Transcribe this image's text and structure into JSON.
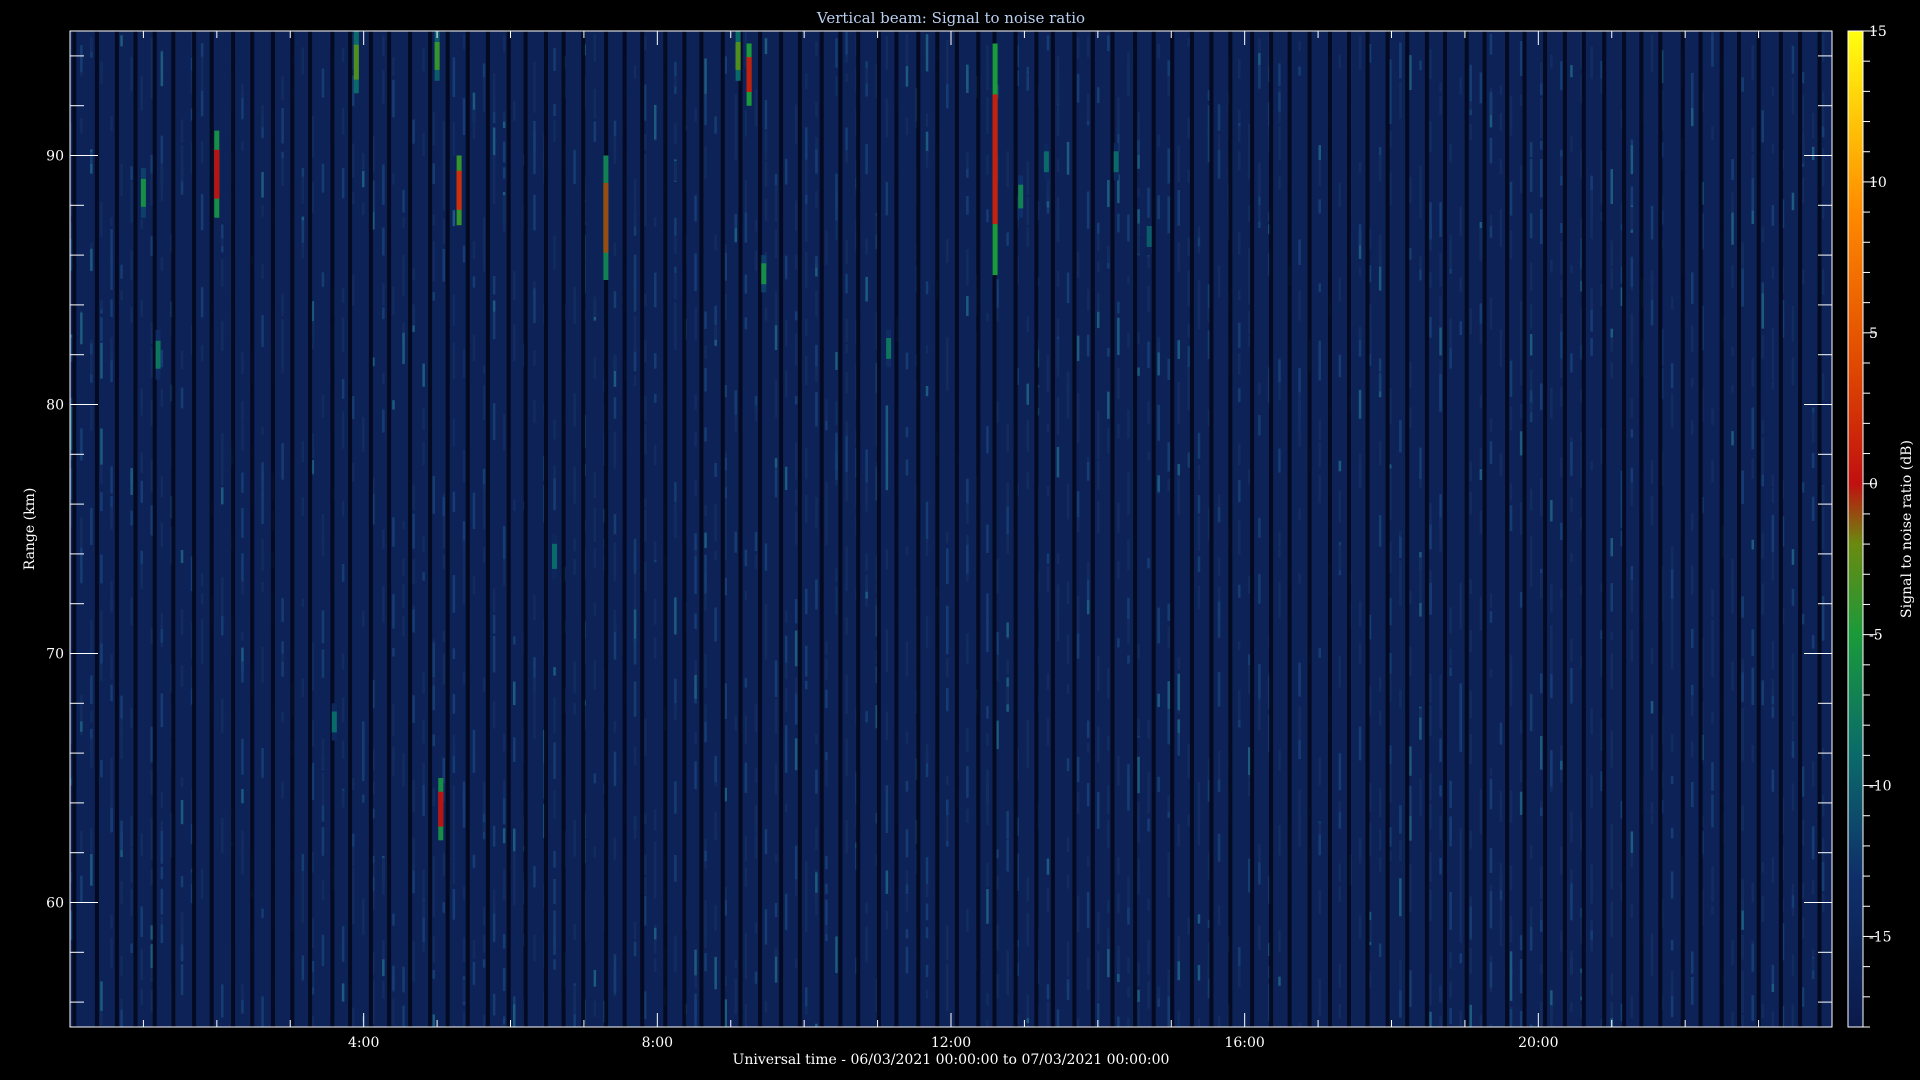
{
  "chart_data": {
    "type": "heatmap",
    "title": "Vertical beam: Signal to noise ratio",
    "xlabel": "Universal time - 06/03/2021 00:00:00 to 07/03/2021 00:00:00",
    "ylabel": "Range (km)",
    "colorbar_label": "Signal to noise ratio (dB)",
    "xlim_hours": [
      0,
      24
    ],
    "ylim_km": [
      55,
      95
    ],
    "clim_db": [
      -18,
      15
    ],
    "x_major_ticks": [
      {
        "hour": 4,
        "label": "4:00"
      },
      {
        "hour": 8,
        "label": "8:00"
      },
      {
        "hour": 12,
        "label": "12:00"
      },
      {
        "hour": 16,
        "label": "16:00"
      },
      {
        "hour": 20,
        "label": "20:00"
      }
    ],
    "y_major_ticks": [
      {
        "km": 60,
        "label": "60"
      },
      {
        "km": 70,
        "label": "70"
      },
      {
        "km": 80,
        "label": "80"
      },
      {
        "km": 90,
        "label": "90"
      }
    ],
    "colorbar_ticks": [
      {
        "db": 15,
        "label": "15"
      },
      {
        "db": 10,
        "label": "10"
      },
      {
        "db": 5,
        "label": "5"
      },
      {
        "db": 0,
        "label": "0"
      },
      {
        "db": -5,
        "label": "-5"
      },
      {
        "db": -10,
        "label": "-10"
      },
      {
        "db": -15,
        "label": "-15"
      }
    ],
    "background_db": -16,
    "colormap": [
      {
        "db": -18,
        "color": "#0b1a4a"
      },
      {
        "db": -13,
        "color": "#0f2f6a"
      },
      {
        "db": -9,
        "color": "#0a6a6a"
      },
      {
        "db": -5,
        "color": "#1a9a3a"
      },
      {
        "db": -2,
        "color": "#6a8a10"
      },
      {
        "db": 0,
        "color": "#c01010"
      },
      {
        "db": 4,
        "color": "#e04a00"
      },
      {
        "db": 9,
        "color": "#ff8a00"
      },
      {
        "db": 15,
        "color": "#ffff10"
      }
    ],
    "echoes": [
      {
        "hour": 1.0,
        "km_from": 87.5,
        "km_to": 89.5,
        "snr_db": -6
      },
      {
        "hour": 1.2,
        "km_from": 81.0,
        "km_to": 83.0,
        "snr_db": -8
      },
      {
        "hour": 2.0,
        "km_from": 87.5,
        "km_to": 91.0,
        "snr_db": 0
      },
      {
        "hour": 3.6,
        "km_from": 66.5,
        "km_to": 68.0,
        "snr_db": -9
      },
      {
        "hour": 3.9,
        "km_from": 92.5,
        "km_to": 95.0,
        "snr_db": -3
      },
      {
        "hour": 5.0,
        "km_from": 93.0,
        "km_to": 95.0,
        "snr_db": -4
      },
      {
        "hour": 5.05,
        "km_from": 62.5,
        "km_to": 65.0,
        "snr_db": 0
      },
      {
        "hour": 5.3,
        "km_from": 87.2,
        "km_to": 90.0,
        "snr_db": 2
      },
      {
        "hour": 6.6,
        "km_from": 73.0,
        "km_to": 74.8,
        "snr_db": -9
      },
      {
        "hour": 7.3,
        "km_from": 85.0,
        "km_to": 90.0,
        "snr_db": -1
      },
      {
        "hour": 9.1,
        "km_from": 93.0,
        "km_to": 95.0,
        "snr_db": -3
      },
      {
        "hour": 9.25,
        "km_from": 92.0,
        "km_to": 94.5,
        "snr_db": 1
      },
      {
        "hour": 9.45,
        "km_from": 84.5,
        "km_to": 86.0,
        "snr_db": -6
      },
      {
        "hour": 11.15,
        "km_from": 81.5,
        "km_to": 83.0,
        "snr_db": -8
      },
      {
        "hour": 12.6,
        "km_from": 85.2,
        "km_to": 94.5,
        "snr_db": 1
      },
      {
        "hour": 12.95,
        "km_from": 87.5,
        "km_to": 89.2,
        "snr_db": -7
      },
      {
        "hour": 13.3,
        "km_from": 89.0,
        "km_to": 90.5,
        "snr_db": -9
      },
      {
        "hour": 14.25,
        "km_from": 89.0,
        "km_to": 90.5,
        "snr_db": -9
      },
      {
        "hour": 14.7,
        "km_from": 86.0,
        "km_to": 87.5,
        "snr_db": -10
      }
    ]
  }
}
